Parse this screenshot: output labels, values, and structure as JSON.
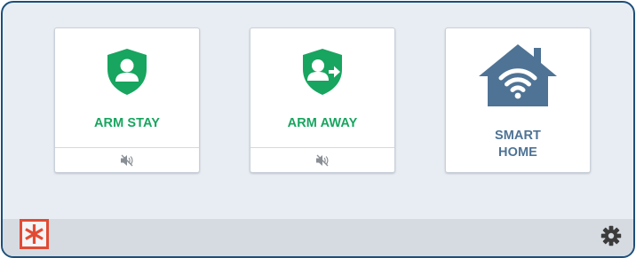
{
  "tiles": [
    {
      "label": "ARM STAY",
      "icon": "shield-person-icon",
      "sub_icon": "speaker-muted-icon"
    },
    {
      "label": "ARM AWAY",
      "icon": "shield-person-arrow-icon",
      "sub_icon": "speaker-muted-icon"
    },
    {
      "label_line1": "SMART",
      "label_line2": "HOME",
      "icon": "house-wifi-icon"
    }
  ],
  "footer": {
    "logo_icon": "asterisk-logo-icon",
    "settings_icon": "gear-icon"
  },
  "colors": {
    "frame": "#1d4f7a",
    "panel_bg": "#e8edf3",
    "arm_green": "#17a55f",
    "smart_home_blue": "#4e7395",
    "logo_red": "#e24b33",
    "gear_dark": "#3b3b3b"
  }
}
